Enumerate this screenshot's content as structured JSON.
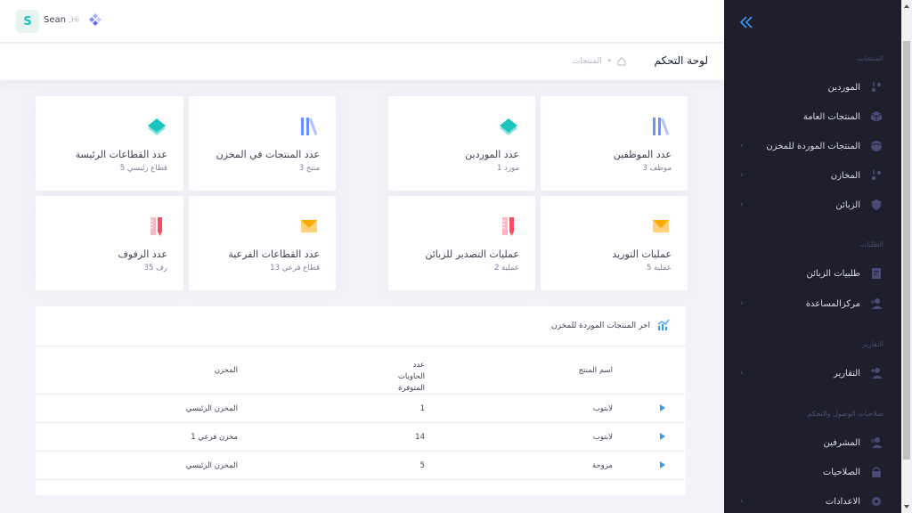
{
  "header": {
    "avatar_letter": "S",
    "user_name": "Sean",
    "greeting": ",Hi"
  },
  "subheader": {
    "title": "لوحة التحكم",
    "breadcrumb": "المنتجات"
  },
  "cards": [
    {
      "title": "عدد الموظفين",
      "sub": "3 موظف",
      "icon": "books-icon",
      "color": "#6993ff"
    },
    {
      "title": "عدد الموردين",
      "sub": "1 مورد",
      "icon": "layers-icon",
      "color": "#1bc5bd"
    },
    {
      "title": "عدد المنتجات في المخزن",
      "sub": "3 منتج",
      "icon": "books-icon",
      "color": "#6993ff"
    },
    {
      "title": "عدد القطاعات الرئيسة",
      "sub": "5 قطاع رئيسي",
      "icon": "layers-icon",
      "color": "#1bc5bd"
    },
    {
      "title": "عمليات التوريد",
      "sub": "5 عملية",
      "icon": "mail-icon",
      "color": "#ffa800"
    },
    {
      "title": "عمليات التصدير للزبائن",
      "sub": "2 عملية",
      "icon": "ruler-icon",
      "color": "#f64e60"
    },
    {
      "title": "عدد القطاعات الفرعية",
      "sub": "13 قطاع فرعي",
      "icon": "mail-icon",
      "color": "#ffa800"
    },
    {
      "title": "عدد الرفوف",
      "sub": "35 رف",
      "icon": "ruler-icon",
      "color": "#f64e60"
    }
  ],
  "table": {
    "title": "اخر المنتجات الموردة للمخزن",
    "columns": [
      "اسم المنتج",
      "عدد الحاويات المتوفرة",
      "المخزن"
    ],
    "rows": [
      {
        "name": "لابتوب",
        "qty": "1",
        "store": "المخزن الرئيسي"
      },
      {
        "name": "لابتوب",
        "qty": "14",
        "store": "مخزن فرعي 1"
      },
      {
        "name": "مروحة",
        "qty": "5",
        "store": "المخزن الرئيسي"
      }
    ]
  },
  "sidebar": {
    "sections": [
      {
        "label": "المنتجات"
      },
      {
        "label": "الطلبات"
      },
      {
        "label": "التقارير"
      },
      {
        "label": "صلاحيات الوصول والتحكم"
      }
    ],
    "items": [
      {
        "label": "الموردين",
        "icon": "truck-icon",
        "chevron": false
      },
      {
        "label": "المنتجات العامة",
        "icon": "box-icon",
        "chevron": false
      },
      {
        "label": "المنتجات الموردة للمخزن",
        "icon": "globe-icon",
        "chevron": true
      },
      {
        "label": "المخازن",
        "icon": "truck-icon",
        "chevron": true
      },
      {
        "label": "الزبائن",
        "icon": "shield-icon",
        "chevron": true
      },
      {
        "label": "طلبيات الزبائن",
        "icon": "document-icon",
        "chevron": false
      },
      {
        "label": "مركزالمساعدة",
        "icon": "users-icon",
        "chevron": true
      },
      {
        "label": "التقارير",
        "icon": "user-plus-icon",
        "chevron": true
      },
      {
        "label": "المشرفين",
        "icon": "users-icon",
        "chevron": false
      },
      {
        "label": "الصلاحيات",
        "icon": "lock-icon",
        "chevron": false
      },
      {
        "label": "الاعدادات",
        "icon": "gear-icon",
        "chevron": true
      }
    ]
  },
  "colors": {
    "sidebar_bg": "#1e1e2d",
    "accent_blue": "#3699ff",
    "green": "#1bc5bd"
  }
}
